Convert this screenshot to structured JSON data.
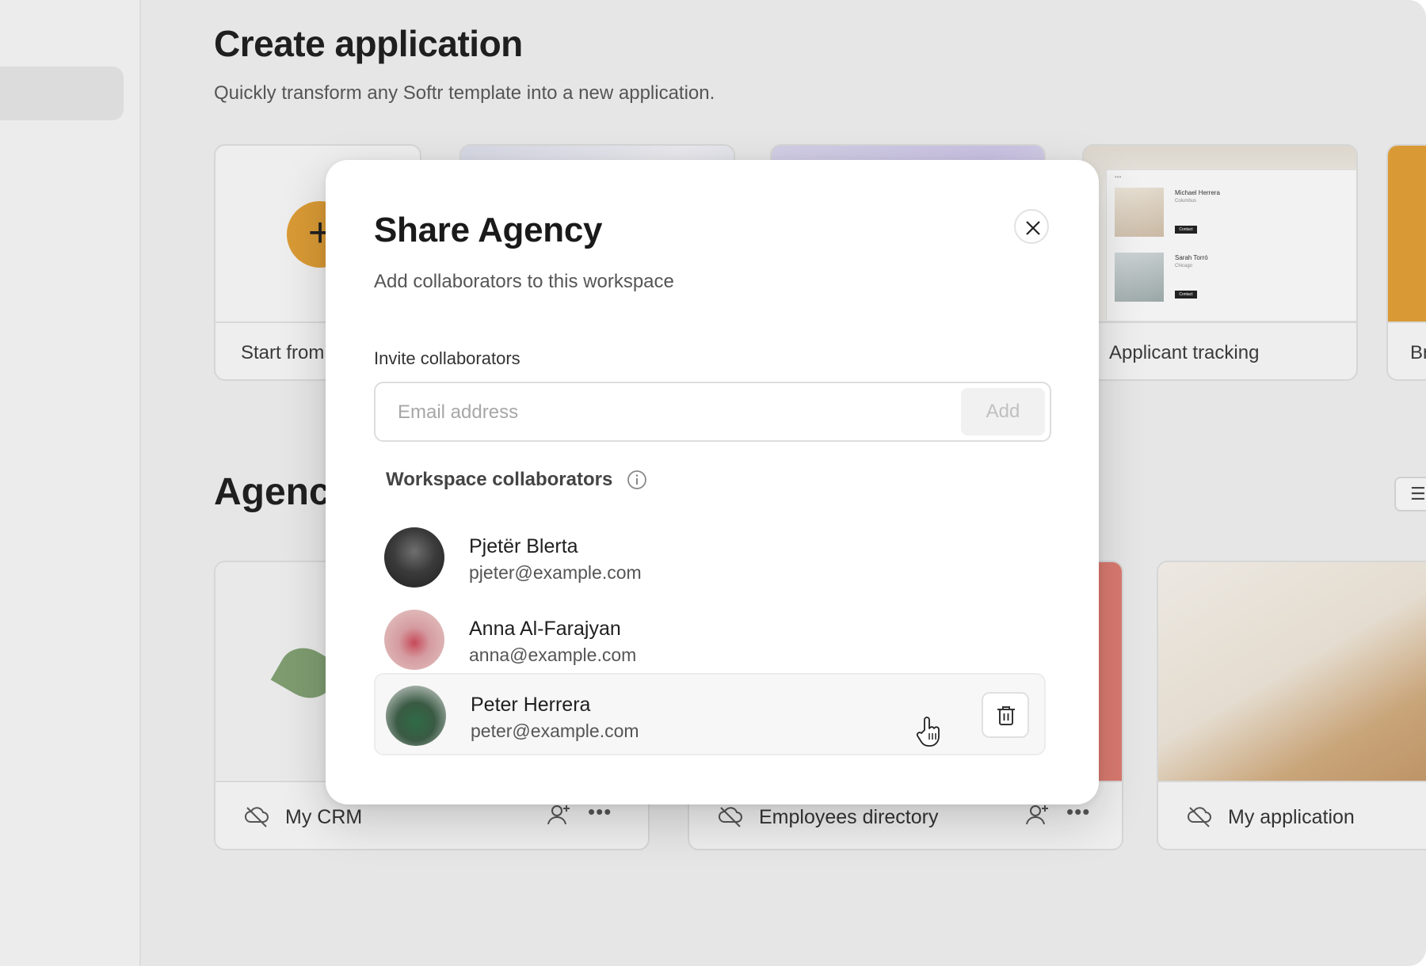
{
  "page": {
    "title": "Create application",
    "subtitle": "Quickly transform any Softr template into a new application."
  },
  "templates": [
    {
      "label": "Start from"
    },
    {
      "label": ""
    },
    {
      "label": ""
    },
    {
      "label": "Applicant tracking"
    },
    {
      "label": "Br"
    }
  ],
  "template_preview": {
    "person1_name": "Michael Herrera",
    "person1_city": "Columbus",
    "person2_name": "Sarah Torró",
    "person2_city": "Chicago",
    "contact_label": "Contact"
  },
  "section": {
    "title": "Agenc"
  },
  "apps": [
    {
      "name": "My CRM"
    },
    {
      "name": "Employees directory"
    },
    {
      "name": "My application"
    }
  ],
  "modal": {
    "title": "Share Agency",
    "subtitle": "Add collaborators to this workspace",
    "invite_label": "Invite collaborators",
    "email_placeholder": "Email address",
    "add_label": "Add",
    "collaborators_heading": "Workspace collaborators",
    "collaborators": [
      {
        "name": "Pjetër Blerta",
        "email": "pjeter@example.com"
      },
      {
        "name": "Anna Al-Farajyan",
        "email": "anna@example.com"
      },
      {
        "name": "Peter Herrera",
        "email": "peter@example.com"
      }
    ]
  },
  "colors": {
    "accent": "#d99a35",
    "background": "#e6e6e6",
    "modal": "#ffffff"
  }
}
